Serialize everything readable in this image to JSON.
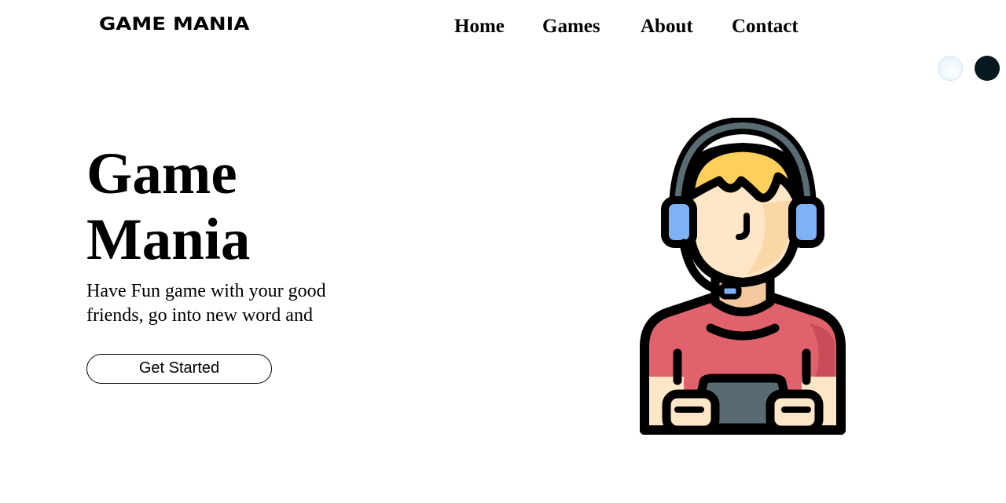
{
  "brand": {
    "logo_text": "GAME MANIA"
  },
  "nav": {
    "items": [
      "Home",
      "Games",
      "About",
      "Contact"
    ]
  },
  "theme": {
    "options": [
      "light-theme",
      "dark-theme"
    ],
    "colors": {
      "light": "#e4f3fa",
      "dark": "#06191f"
    }
  },
  "hero": {
    "title_line1": "Game",
    "title_line2": "Mania",
    "text_line1": "Have Fun game with your good",
    "text_line2": "friends, go into new word and",
    "cta_label": "Get Started"
  },
  "illustration": {
    "icon": "gamer-with-headset-icon",
    "colors": {
      "hair": "#ffcf5c",
      "skin": "#ffe6c7",
      "shirt": "#e0626c",
      "headset": "#5a6c74",
      "earpad": "#7fb2f5",
      "controller": "#596a72",
      "outline": "#000000"
    }
  }
}
